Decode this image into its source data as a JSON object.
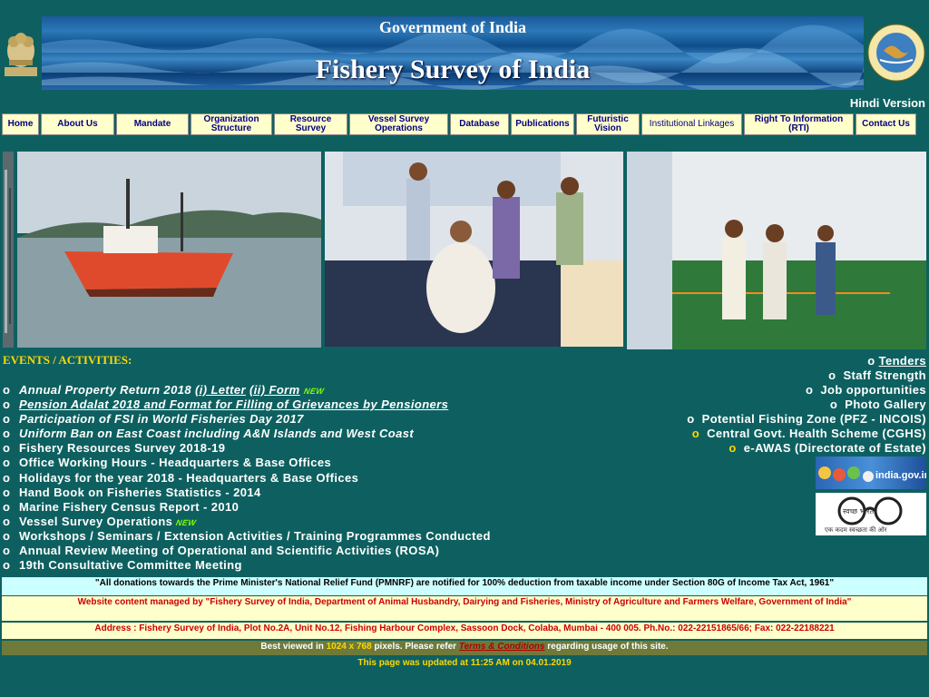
{
  "header": {
    "gov_title": "Government of India",
    "site_title": "Fishery Survey of India",
    "hindi_link": "Hindi Version"
  },
  "nav": [
    "Home",
    "About Us",
    "Mandate",
    "Organization Structure",
    "Resource Survey",
    "Vessel Survey Operations",
    "Database",
    "Publications",
    "Futuristic Vision",
    "Institutional Linkages",
    "Right To Information (RTI)",
    "Contact Us"
  ],
  "events": {
    "heading": "EVENTS / ACTIVITIES:",
    "bullet": "o",
    "item0_a": "Annual Property Return 2018",
    "item0_b": "(i) Letter",
    "item0_c": "(ii) Form",
    "new_badge": "NEW",
    "item1": "Pension Adalat 2018 and Format for Filling of Grievances by Pensioners",
    "item2": "Participation of FSI in World Fisheries Day 2017",
    "item3": "Uniform Ban on East Coast including A&N Islands and West Coast",
    "item4": "Fishery Resources Survey 2018-19",
    "item5": "Office Working Hours - Headquarters & Base Offices",
    "item6": "Holidays for the year 2018 - Headquarters & Base Offices",
    "item7": "Hand Book on Fisheries  Statistics - 2014",
    "item8": "Marine Fishery Census Report  - 2010",
    "item9": "Vessel Survey Operations",
    "item10": "Workshops / Seminars / Extension Activities / Training Programmes Conducted",
    "item11": "Annual Review Meeting of Operational and Scientific Activities (ROSA)",
    "item12": "19th Consultative Committee Meeting"
  },
  "right_links": {
    "tenders": "Tenders",
    "staff": "Staff Strength",
    "jobs": "Job opportunities",
    "gallery": "Photo Gallery",
    "pfz": "Potential Fishing Zone (PFZ - INCOIS)",
    "cghs": "Central Govt. Health Scheme (CGHS)",
    "eawas": "e-AWAS (Directorate of Estate)",
    "indiagov_text": "india.gov.in",
    "swachh_text": "स्वच्छ भारत",
    "swachh_sub": "एक कदम स्वच्छता की ओर"
  },
  "footer": {
    "pmnrf": "\"All donations towards the Prime Minister's National Relief Fund (PMNRF) are notified for 100% deduction from taxable income under Section 80G of Income Tax Act, 1961\"",
    "managed": "Website content managed by  \"Fishery Survey of India, Department of Animal Husbandry, Dairying and Fisheries, Ministry of Agriculture and Farmers Welfare, Government of India\"",
    "address": "Address : Fishery Survey of India, Plot No.2A, Unit No.12, Fishing Harbour Complex, Sassoon Dock, Colaba, Mumbai - 400 005. Ph.No.: 022-22151865/66; Fax: 022-22188221",
    "best_a": "Best viewed in ",
    "best_res": "1024 x 768",
    "best_b": " pixels.     Please refer ",
    "terms": "Terms & Conditions",
    "best_c": " regarding usage of this site.",
    "updated": "This page was updated at 11:25 AM  on 04.01.2019"
  },
  "colors": {
    "background": "#0e6060",
    "nav_bg": "#ffffcc",
    "heading_gold": "#ffd700"
  }
}
